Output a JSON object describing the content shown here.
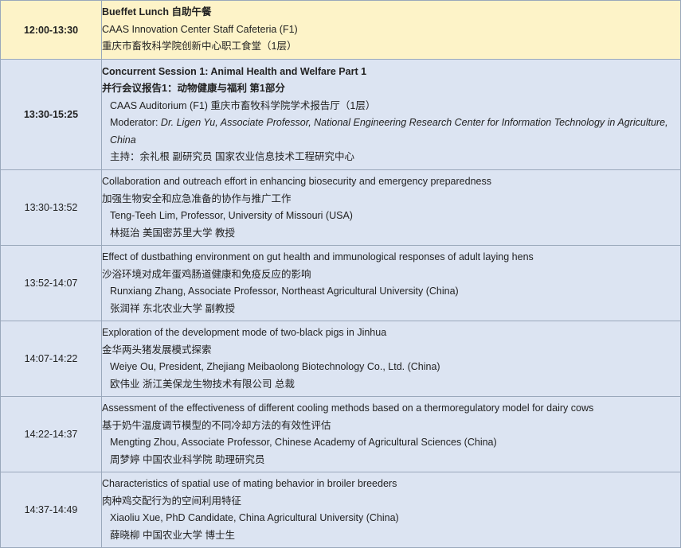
{
  "rows": [
    {
      "time": "12:00-13:30",
      "title": "Bueffet Lunch 自助午餐",
      "venue_en": "CAAS Innovation Center Staff Cafeteria (F1)",
      "venue_cn": "重庆市畜牧科学院创新中心职工食堂（1层）"
    },
    {
      "time": "13:30-15:25",
      "title_en": "Concurrent Session 1: Animal Health and Welfare Part 1",
      "title_cn": "并行会议报告1：动物健康与福利 第1部分",
      "venue": "CAAS Auditorium (F1) 重庆市畜牧科学院学术报告厅（1层）",
      "moderator_label": "Moderator: ",
      "moderator_name": "Dr. Ligen Yu, Associate Professor, National Engineering Research Center for Information Technology in Agriculture, China",
      "moderator_cn": "主持：余礼根 副研究员 国家农业信息技术工程研究中心"
    },
    {
      "time": "13:30-13:52",
      "title_en": "Collaboration and outreach effort in enhancing biosecurity and emergency preparedness",
      "title_cn": "加强生物安全和应急准备的协作与推广工作",
      "speaker_en": "Teng-Teeh Lim, Professor, University of Missouri (USA)",
      "speaker_cn": "林挺治 美国密苏里大学 教授"
    },
    {
      "time": "13:52-14:07",
      "title_en": "Effect of dustbathing environment on gut health and immunological responses of adult laying hens",
      "title_cn": "沙浴环境对成年蛋鸡肠道健康和免疫反应的影响",
      "speaker_en": "Runxiang Zhang, Associate Professor, Northeast Agricultural University (China)",
      "speaker_cn": "张润祥 东北农业大学 副教授"
    },
    {
      "time": "14:07-14:22",
      "title_en": "Exploration of the development mode of two-black pigs in Jinhua",
      "title_cn": "金华两头猪发展模式探索",
      "speaker_en": "Weiye Ou, President, Zhejiang Meibaolong Biotechnology Co., Ltd. (China)",
      "speaker_cn": "欧伟业 浙江美保龙生物技术有限公司 总裁"
    },
    {
      "time": "14:22-14:37",
      "title_en": "Assessment of the effectiveness of different cooling methods based on a thermoregulatory model for dairy cows",
      "title_cn": "基于奶牛温度调节模型的不同冷却方法的有效性评估",
      "speaker_en": "Mengting Zhou, Associate Professor, Chinese Academy of Agricultural Sciences (China)",
      "speaker_cn": "周梦婷 中国农业科学院 助理研究员"
    },
    {
      "time": "14:37-14:49",
      "title_en": "Characteristics of spatial use of mating behavior in broiler breeders",
      "title_cn": "肉种鸡交配行为的空间利用特征",
      "speaker_en": "Xiaoliu Xue, PhD Candidate, China Agricultural University (China)",
      "speaker_cn": "薛晓柳 中国农业大学 博士生"
    }
  ]
}
